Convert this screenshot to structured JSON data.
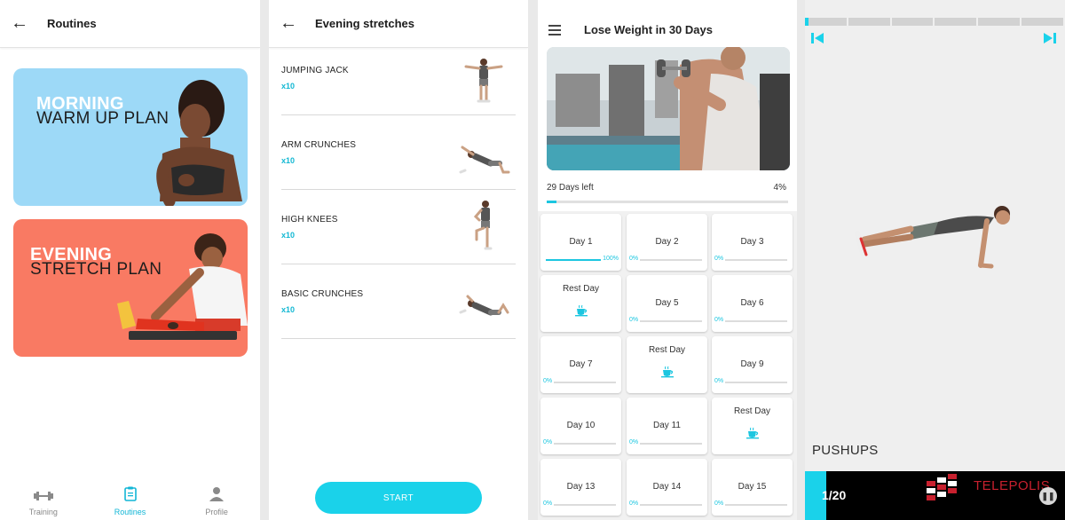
{
  "routines_screen": {
    "title": "Routines",
    "plans": [
      {
        "line1": "MORNING",
        "line2": "WARM UP PLAN",
        "bg": "#9dd9f7"
      },
      {
        "line1": "EVENING",
        "line2": "STRETCH PLAN",
        "bg": "#f97a63"
      }
    ],
    "nav": [
      {
        "label": "Training",
        "icon": "dumbbell-icon",
        "active": false
      },
      {
        "label": "Routines",
        "icon": "clipboard-icon",
        "active": true
      },
      {
        "label": "Profile",
        "icon": "person-icon",
        "active": false
      }
    ]
  },
  "stretches_screen": {
    "title": "Evening stretches",
    "exercises": [
      {
        "name": "JUMPING JACK",
        "reps": "x10",
        "icon": "jumping-jack-figure"
      },
      {
        "name": "ARM CRUNCHES",
        "reps": "x10",
        "icon": "arm-crunches-figure"
      },
      {
        "name": "HIGH KNEES",
        "reps": "x10",
        "icon": "high-knees-figure"
      },
      {
        "name": "BASIC CRUNCHES",
        "reps": "x10",
        "icon": "basic-crunches-figure"
      }
    ],
    "start_label": "START"
  },
  "plan_screen": {
    "title": "Lose Weight in 30 Days",
    "days_left": "29 Days left",
    "percent": "4%",
    "progress_fraction": 0.04,
    "days": [
      {
        "label": "Day 1",
        "progress": "100%",
        "fill": 1.0,
        "rest": false
      },
      {
        "label": "Day 2",
        "progress": "0%",
        "fill": 0,
        "rest": false
      },
      {
        "label": "Day 3",
        "progress": "0%",
        "fill": 0,
        "rest": false
      },
      {
        "label": "Rest Day",
        "progress": "",
        "fill": 0,
        "rest": true
      },
      {
        "label": "Day 5",
        "progress": "0%",
        "fill": 0,
        "rest": false
      },
      {
        "label": "Day 6",
        "progress": "0%",
        "fill": 0,
        "rest": false
      },
      {
        "label": "Day 7",
        "progress": "0%",
        "fill": 0,
        "rest": false
      },
      {
        "label": "Rest Day",
        "progress": "",
        "fill": 0,
        "rest": true
      },
      {
        "label": "Day 9",
        "progress": "0%",
        "fill": 0,
        "rest": false
      },
      {
        "label": "Day 10",
        "progress": "0%",
        "fill": 0,
        "rest": false
      },
      {
        "label": "Day 11",
        "progress": "0%",
        "fill": 0,
        "rest": false
      },
      {
        "label": "Rest Day",
        "progress": "",
        "fill": 0,
        "rest": true
      },
      {
        "label": "Day 13",
        "progress": "0%",
        "fill": 0,
        "rest": false
      },
      {
        "label": "Day 14",
        "progress": "0%",
        "fill": 0,
        "rest": false
      },
      {
        "label": "Day 15",
        "progress": "0%",
        "fill": 0,
        "rest": false
      }
    ],
    "accent": "#1cc6e0"
  },
  "workout_screen": {
    "exercise_name": "PUSHUPS",
    "counter": "1/20",
    "segments_total": 6,
    "watermark_text": "TELEPOLIS",
    "accent": "#1ad2ea"
  }
}
